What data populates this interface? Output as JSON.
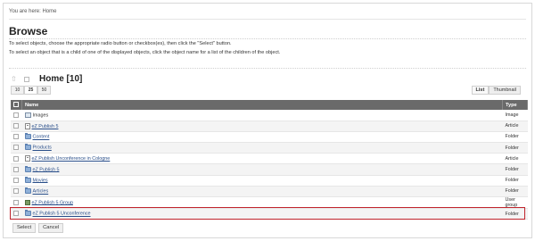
{
  "breadcrumb": "You are here: Home",
  "page_title": "Browse",
  "description": [
    "To select objects, choose the appropriate radio button or checkbox(es), then click the \"Select\" button.",
    "To select an object that is a child of one of the displayed objects, click the object name for a list of the children of the object."
  ],
  "node": {
    "title": "Home [10]"
  },
  "limits": [
    {
      "label": "10"
    },
    {
      "label": "25",
      "active": true
    },
    {
      "label": "50"
    }
  ],
  "views": [
    {
      "label": "List",
      "active": true
    },
    {
      "label": "Thumbnail"
    }
  ],
  "table": {
    "headers": {
      "name": "Name",
      "type": "Type"
    },
    "rows": [
      {
        "name": "Images",
        "type": "Image",
        "icon": "image-icon",
        "linked": false
      },
      {
        "name": "eZ Publish 5",
        "type": "Article",
        "icon": "article-icon",
        "linked": true
      },
      {
        "name": "Content",
        "type": "Folder",
        "icon": "folder-icon",
        "linked": true
      },
      {
        "name": "Products",
        "type": "Folder",
        "icon": "folder-icon",
        "linked": true
      },
      {
        "name": "eZ Publish Unconference in Cologne",
        "type": "Article",
        "icon": "article-icon",
        "linked": true
      },
      {
        "name": "eZ Publish 5",
        "type": "Folder",
        "icon": "folder-icon",
        "linked": true
      },
      {
        "name": "Movies",
        "type": "Folder",
        "icon": "folder-icon",
        "linked": true
      },
      {
        "name": "Articles",
        "type": "Folder",
        "icon": "folder-icon",
        "linked": true
      },
      {
        "name": "eZ Publish 5 Group",
        "type": "User group",
        "icon": "user-group-icon",
        "linked": true
      },
      {
        "name": "eZ Publish 5 Unconference",
        "type": "Folder",
        "icon": "folder-icon",
        "linked": true,
        "highlighted": true
      }
    ]
  },
  "actions": {
    "select": "Select",
    "cancel": "Cancel"
  },
  "colors": {
    "highlight_border": "#c0242c",
    "link": "#2a4f8a",
    "header_bg": "#6a6a6a"
  }
}
